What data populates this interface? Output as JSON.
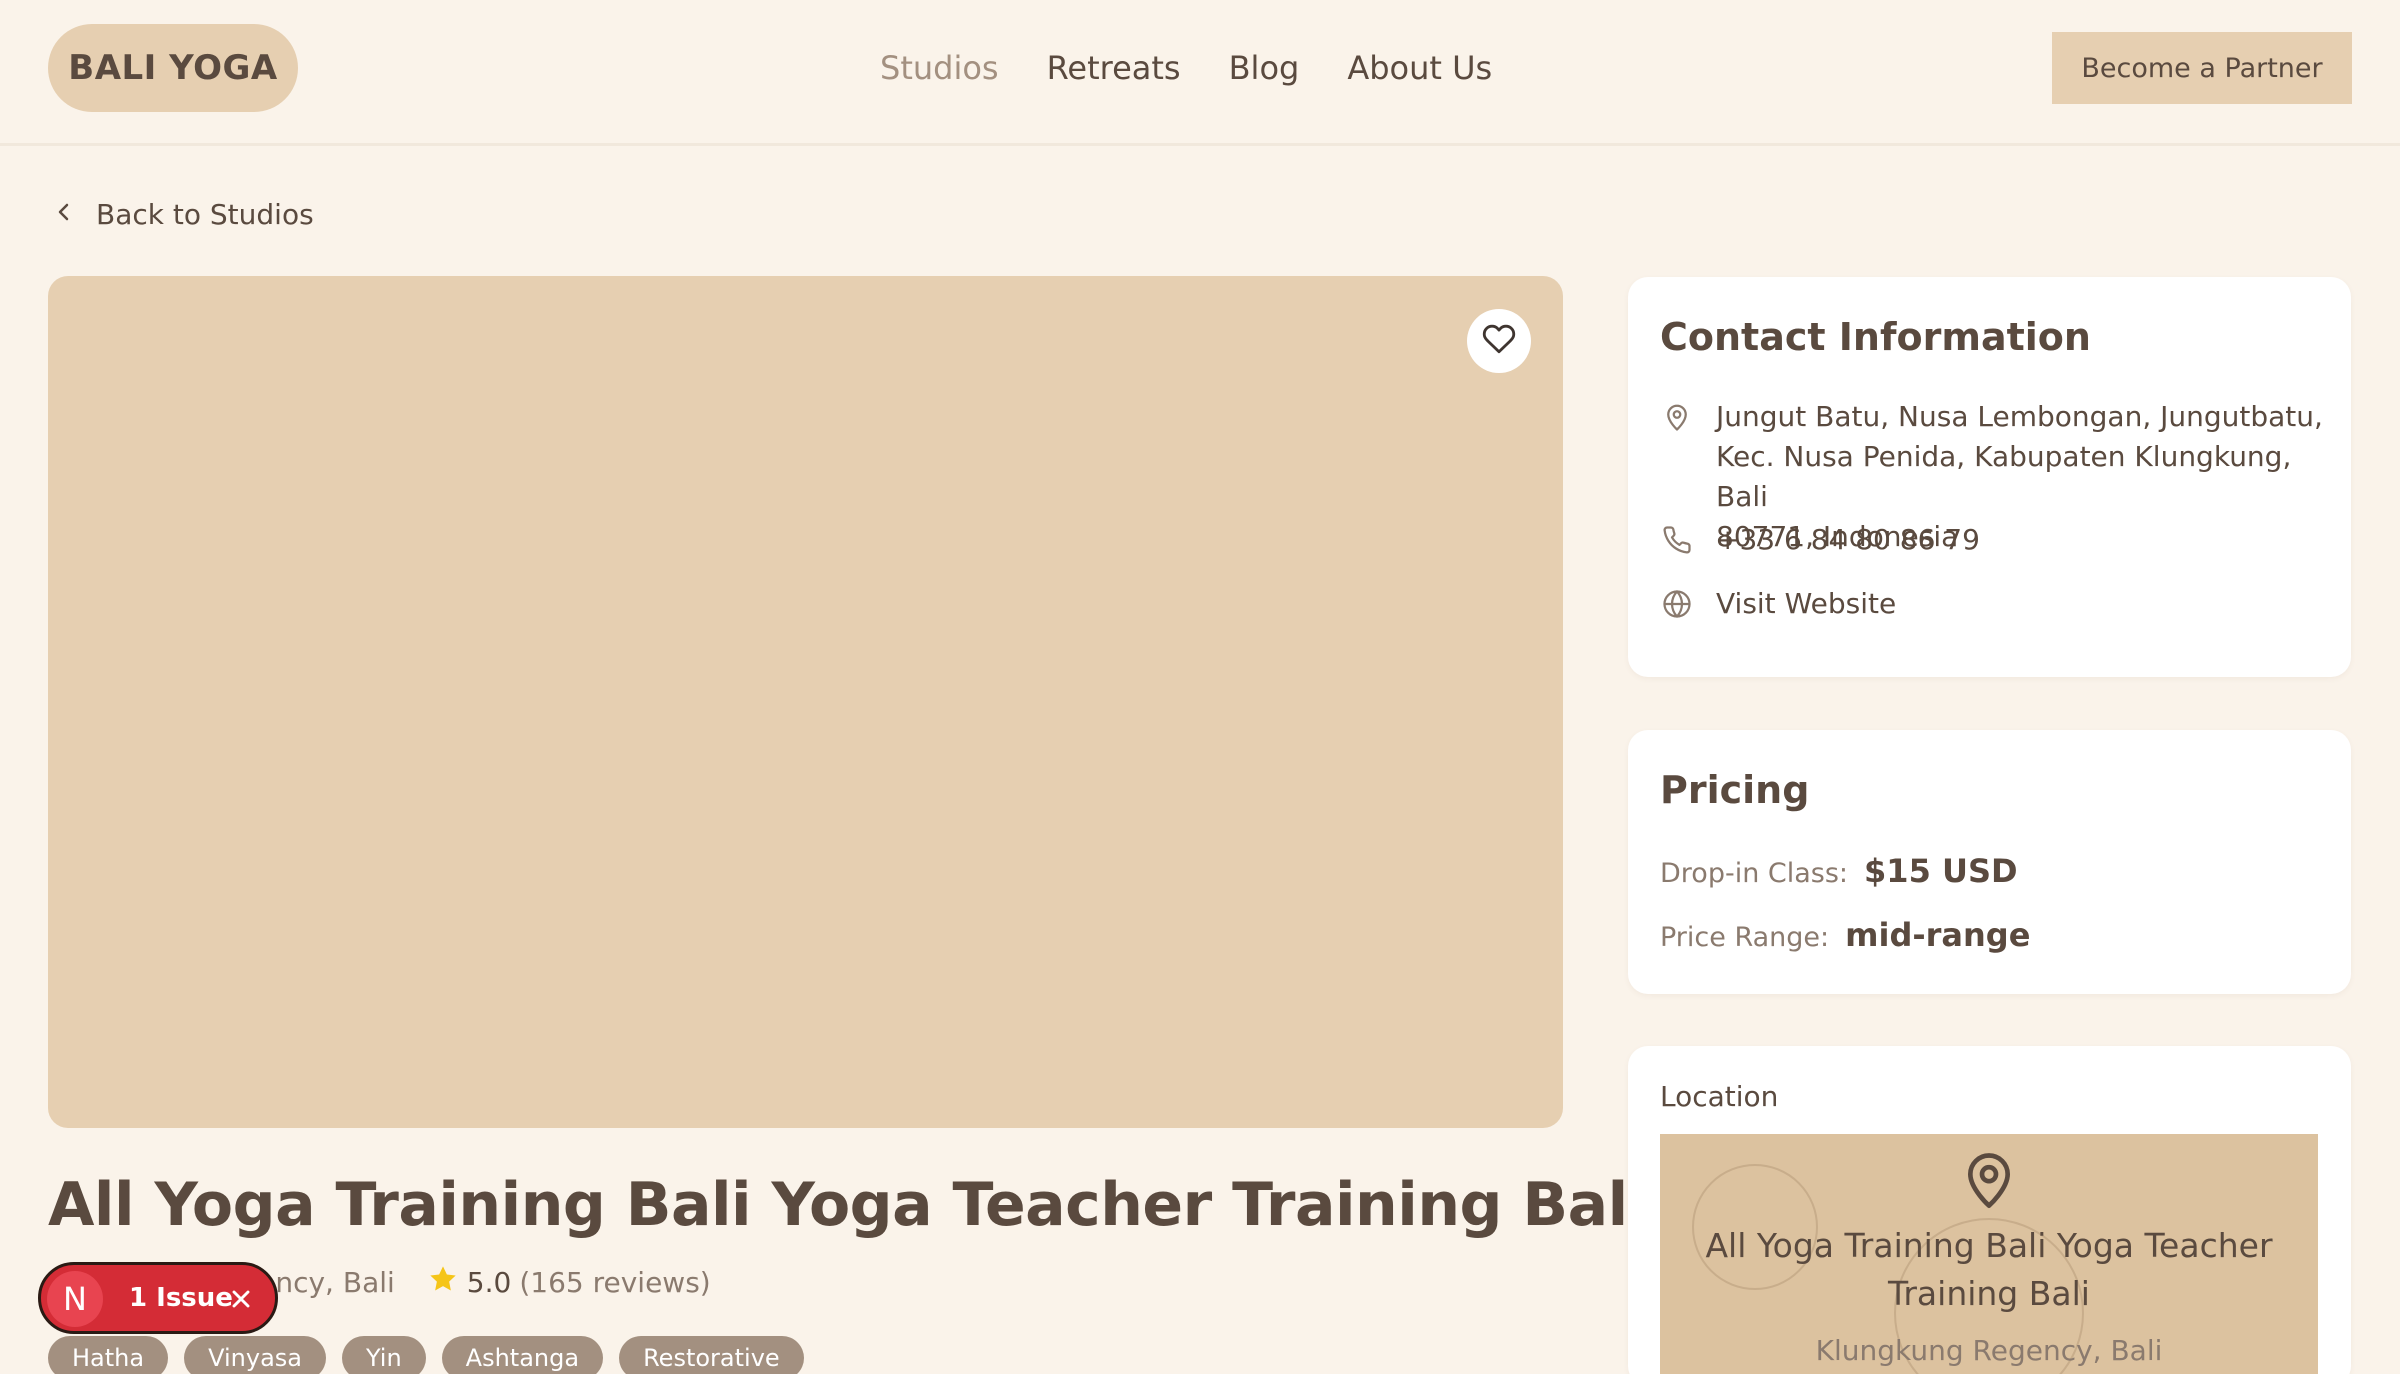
{
  "header": {
    "logo": "BALI YOGA",
    "nav": [
      "Studios",
      "Retreats",
      "Blog",
      "About Us"
    ],
    "partner_button": "Become a Partner"
  },
  "back_link": "Back to Studios",
  "studio": {
    "name": "All Yoga Training Bali Yoga Teacher Training Bali",
    "location": "Klungkung Regency, Bali",
    "rating": "5.0",
    "reviews": "(165 reviews)",
    "tags": [
      "Hatha",
      "Vinyasa",
      "Yin",
      "Ashtanga",
      "Restorative"
    ]
  },
  "issue_badge": {
    "initial": "N",
    "label": "1 Issue"
  },
  "contact": {
    "title": "Contact Information",
    "address_line1": "Jungut Batu, Nusa Lembongan, Jungutbatu,",
    "address_line2": "Kec. Nusa Penida, Kabupaten Klungkung, Bali",
    "address_line3": "80771, Indonesia",
    "phone": "+33 6 84 80 86 79",
    "website": "Visit Website"
  },
  "pricing": {
    "title": "Pricing",
    "dropin_label": "Drop-in Class:",
    "dropin_value": "$15 USD",
    "range_label": "Price Range:",
    "range_value": "mid-range"
  },
  "location_card": {
    "title": "Location",
    "map_title": "All Yoga Training Bali Yoga Teacher Training Bali",
    "map_subtitle": "Klungkung Regency, Bali"
  },
  "icons": {
    "back": "chevron-left-icon",
    "favorite": "heart-icon",
    "rating": "star-icon",
    "address": "map-pin-icon",
    "phone": "phone-icon",
    "website": "globe-icon",
    "issue_close": "close-icon"
  },
  "colors": {
    "background": "#faf3ea",
    "accent": "#e6cfb1",
    "text": "#5a4a3f",
    "muted": "#8a7a6e",
    "star": "#f5c518",
    "issue": "#d42c36"
  }
}
